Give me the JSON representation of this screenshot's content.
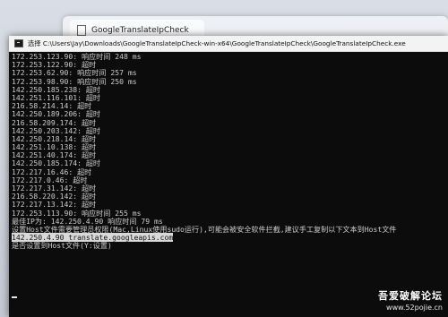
{
  "browser_tab": {
    "label": "GoogleTranslateIpCheck"
  },
  "console": {
    "title": "选择 C:\\Users\\Jay\\Downloads\\GoogleTranslateIpCheck-win-x64\\GoogleTranslateIpCheck\\GoogleTranslateIpCheck.exe",
    "lines": [
      "172.253.123.90: 响应时间 248 ms",
      "172.253.122.90: 超时",
      "172.253.62.90: 响应时间 257 ms",
      "172.253.98.90: 响应时间 250 ms",
      "142.250.185.238: 超时",
      "142.251.116.101: 超时",
      "216.58.214.14: 超时",
      "142.250.189.206: 超时",
      "216.58.209.174: 超时",
      "142.250.203.142: 超时",
      "142.250.218.14: 超时",
      "142.251.10.138: 超时",
      "142.251.40.174: 超时",
      "142.250.185.174: 超时",
      "172.217.16.46: 超时",
      "172.217.0.46: 超时",
      "172.217.31.142: 超时",
      "216.58.220.142: 超时",
      "172.217.13.142: 超时",
      "172.253.113.90: 响应时间 255 ms",
      "最佳IP为: 142.250.4.90 响应时间 79 ms",
      "设置Host文件需要管理员权限(Mac,Linux使用sudo运行),可能会被安全软件拦截,建议手工复制以下文本到Host文件"
    ],
    "selected_line": "142.250.4.90 translate.googleapis.com",
    "prompt_line": "是否设置到Host文件(Y:设置)"
  },
  "watermark": {
    "title": "吾爱破解论坛",
    "url": "www.52pojie.cn"
  },
  "colors": {
    "console_bg": "#0c0c0c",
    "console_text": "#cccccc",
    "selection_bg": "#d9d9d9",
    "titlebar_bg": "#f3f3f3"
  }
}
